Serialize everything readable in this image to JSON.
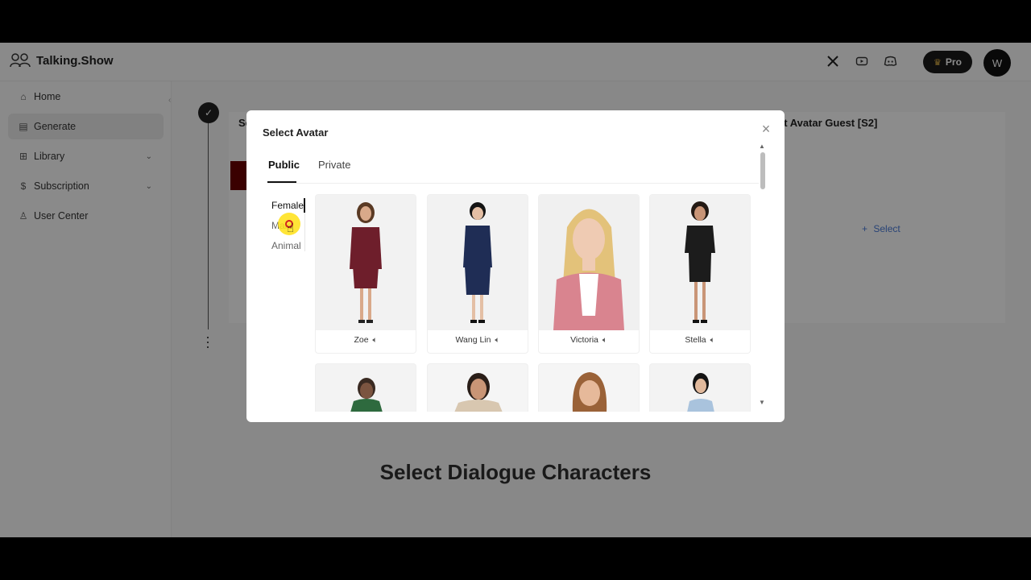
{
  "app": {
    "name": "Talking.Show"
  },
  "header": {
    "icons": [
      "x-icon",
      "youtube-icon",
      "discord-icon"
    ],
    "pro_label": "Pro",
    "user_initial": "W"
  },
  "sidebar": {
    "items": [
      {
        "label": "Home",
        "icon": "home-icon"
      },
      {
        "label": "Generate",
        "icon": "document-icon",
        "active": true
      },
      {
        "label": "Library",
        "icon": "grid-icon",
        "expandable": true
      },
      {
        "label": "Subscription",
        "icon": "dollar-icon",
        "expandable": true
      },
      {
        "label": "User Center",
        "icon": "user-icon"
      }
    ]
  },
  "background": {
    "left_title": "Se",
    "right_title": "ct Avatar Guest [S2]",
    "select_link": "Select"
  },
  "modal": {
    "title": "Select Avatar",
    "tabs": [
      "Public",
      "Private"
    ],
    "active_tab": "Public",
    "categories": [
      "Female",
      "Male",
      "Animal"
    ],
    "active_category": "Female",
    "avatars": [
      {
        "name": "Zoe",
        "outfit": "#6e1e2b",
        "skin": "#d9a98a",
        "hair": "#5a3a24"
      },
      {
        "name": "Wang Lin",
        "outfit": "#1f2d55",
        "skin": "#e4bfa5",
        "hair": "#141414"
      },
      {
        "name": "Victoria",
        "outfit": "#d9848f",
        "skin": "#efcbb3",
        "hair": "#e3c27a"
      },
      {
        "name": "Stella",
        "outfit": "#1c1c1c",
        "skin": "#c99577",
        "hair": "#241a14"
      }
    ],
    "second_row_colors": [
      "#2e6a3e",
      "#d8c7b0",
      "#c98f66",
      "#a9c3dd"
    ],
    "speaker_icon": "speaker-icon"
  },
  "caption": "Select Dialogue Characters",
  "colors": {
    "accent": "#4a7bd8",
    "dark": "#1a1a1a",
    "crown": "#e9b949"
  }
}
